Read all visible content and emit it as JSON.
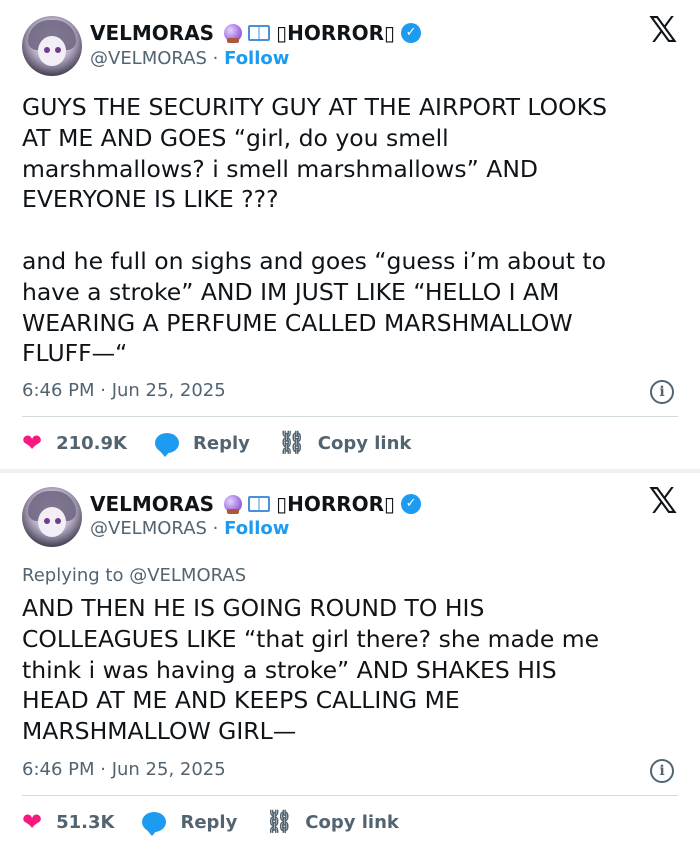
{
  "tweets": [
    {
      "author": {
        "name": "VELMORAS",
        "tag": "▯HORROR▯",
        "handle": "@VELMORAS",
        "follow_label": "Follow"
      },
      "text": "GUYS THE SECURITY GUY AT THE AIRPORT LOOKS\nAT ME AND GOES “girl, do you smell\nmarshmallows? i smell marshmallows” AND\nEVERYONE IS LIKE ???\n\nand he full on sighs and goes “guess i’m about to\nhave a stroke” AND IM JUST LIKE “HELLO I AM\nWEARING A PERFUME CALLED MARSHMALLOW\nFLUFF—“",
      "timestamp": "6:46 PM · Jun 25, 2025",
      "likes": "210.9K",
      "reply_label": "Reply",
      "copy_label": "Copy link"
    },
    {
      "author": {
        "name": "VELMORAS",
        "tag": "▯HORROR▯",
        "handle": "@VELMORAS",
        "follow_label": "Follow"
      },
      "replying_to": "Replying to @VELMORAS",
      "text": "AND THEN HE IS GOING ROUND TO HIS\nCOLLEAGUES LIKE “that girl there? she made me\nthink i was having a stroke” AND SHAKES HIS\nHEAD AT ME AND KEEPS CALLING ME\nMARSHMALLOW GIRL—",
      "timestamp": "6:46 PM · Jun 25, 2025",
      "likes": "51.3K",
      "reply_label": "Reply",
      "copy_label": "Copy link"
    }
  ],
  "icons": {
    "x_logo": "x-logo",
    "verified": "verified-badge",
    "heart": "heart-icon",
    "reply": "reply-icon",
    "link": "link-icon",
    "info": "info-icon",
    "emoji": [
      "crystal-ball-icon",
      "open-book-icon"
    ]
  },
  "colors": {
    "accent": "#1d9bf0",
    "like": "#f91880",
    "secondary_text": "#536471"
  }
}
